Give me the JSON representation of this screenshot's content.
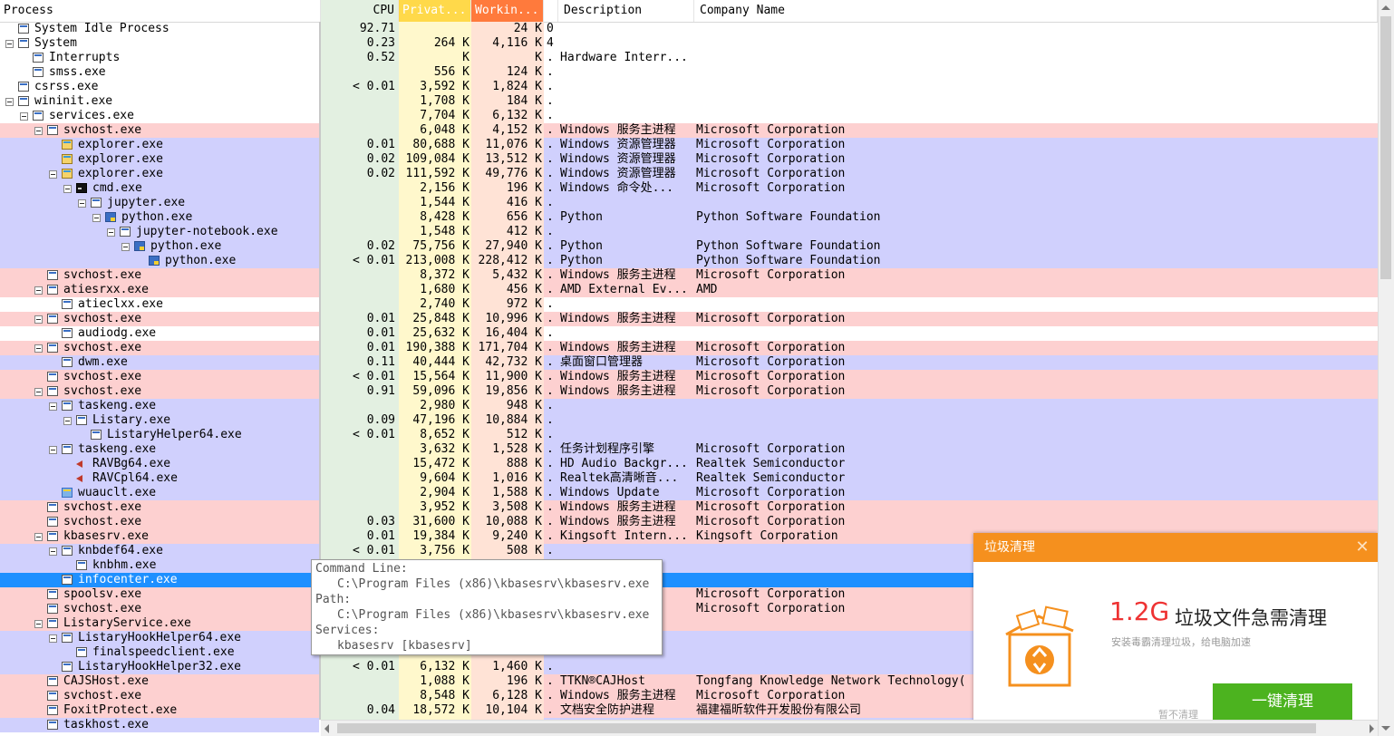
{
  "header": {
    "process": "Process",
    "cpu": "CPU",
    "private": "Privat...",
    "working": "Workin...",
    "description": "Description",
    "company": "Company Name"
  },
  "colors": {
    "service": "#fdd0d0",
    "own_process": "#d0d0fd",
    "selected": "#1e90ff",
    "cpu_column": "#e3f0e1",
    "private_column": "#fff8cc",
    "working_column": "#ffe3d6"
  },
  "processes": [
    {
      "name": "System Idle Process",
      "level": 0,
      "icon": "process-icon",
      "color": "none",
      "cpu": "92.71",
      "private": "",
      "working": "24 K",
      "dot": "0",
      "description": "",
      "company": ""
    },
    {
      "name": "System",
      "level": 0,
      "expand": true,
      "icon": "process-icon",
      "color": "none",
      "cpu": "0.23",
      "private": "264 K",
      "working": "4,116 K",
      "dot": "4",
      "description": "",
      "company": ""
    },
    {
      "name": "Interrupts",
      "level": 1,
      "icon": "process-icon",
      "color": "none",
      "cpu": "0.52",
      "private": "K",
      "working": "K",
      "dot": ".",
      "description": "Hardware Interr...",
      "company": ""
    },
    {
      "name": "smss.exe",
      "level": 1,
      "icon": "process-icon",
      "color": "none",
      "cpu": "",
      "private": "556 K",
      "working": "124 K",
      "dot": ".",
      "description": "",
      "company": ""
    },
    {
      "name": "csrss.exe",
      "level": 0,
      "icon": "process-icon",
      "color": "none",
      "cpu": "< 0.01",
      "private": "3,592 K",
      "working": "1,824 K",
      "dot": ".",
      "description": "",
      "company": ""
    },
    {
      "name": "wininit.exe",
      "level": 0,
      "expand": true,
      "icon": "process-icon",
      "color": "none",
      "cpu": "",
      "private": "1,708 K",
      "working": "184 K",
      "dot": ".",
      "description": "",
      "company": ""
    },
    {
      "name": "services.exe",
      "level": 1,
      "expand": true,
      "icon": "process-icon",
      "color": "none",
      "cpu": "",
      "private": "7,704 K",
      "working": "6,132 K",
      "dot": ".",
      "description": "",
      "company": ""
    },
    {
      "name": "svchost.exe",
      "level": 2,
      "expand": true,
      "icon": "process-icon",
      "color": "pink",
      "cpu": "",
      "private": "6,048 K",
      "working": "4,152 K",
      "dot": ".",
      "description": "Windows 服务主进程",
      "company": "Microsoft Corporation"
    },
    {
      "name": "explorer.exe",
      "level": 3,
      "icon": "explorer-icon",
      "color": "blue",
      "cpu": "0.01",
      "private": "80,688 K",
      "working": "11,076 K",
      "dot": ".",
      "description": "Windows 资源管理器",
      "company": "Microsoft Corporation"
    },
    {
      "name": "explorer.exe",
      "level": 3,
      "icon": "explorer-icon",
      "color": "blue",
      "cpu": "0.02",
      "private": "109,084 K",
      "working": "13,512 K",
      "dot": ".",
      "description": "Windows 资源管理器",
      "company": "Microsoft Corporation"
    },
    {
      "name": "explorer.exe",
      "level": 3,
      "expand": true,
      "icon": "explorer-icon",
      "color": "blue",
      "cpu": "0.02",
      "private": "111,592 K",
      "working": "49,776 K",
      "dot": ".",
      "description": "Windows 资源管理器",
      "company": "Microsoft Corporation"
    },
    {
      "name": "cmd.exe",
      "level": 4,
      "expand": true,
      "icon": "cmd-icon",
      "color": "blue",
      "cpu": "",
      "private": "2,156 K",
      "working": "196 K",
      "dot": ".",
      "description": "Windows 命令处...",
      "company": "Microsoft Corporation"
    },
    {
      "name": "jupyter.exe",
      "level": 5,
      "expand": true,
      "icon": "process-icon",
      "color": "blue",
      "cpu": "",
      "private": "1,544 K",
      "working": "416 K",
      "dot": ".",
      "description": "",
      "company": ""
    },
    {
      "name": "python.exe",
      "level": 6,
      "expand": true,
      "icon": "python-icon",
      "color": "blue",
      "cpu": "",
      "private": "8,428 K",
      "working": "656 K",
      "dot": ".",
      "description": "Python",
      "company": "Python Software Foundation"
    },
    {
      "name": "jupyter-notebook.exe",
      "level": 7,
      "expand": true,
      "icon": "process-icon",
      "color": "blue",
      "cpu": "",
      "private": "1,548 K",
      "working": "412 K",
      "dot": ".",
      "description": "",
      "company": ""
    },
    {
      "name": "python.exe",
      "level": 8,
      "expand": true,
      "icon": "python-icon",
      "color": "blue",
      "cpu": "0.02",
      "private": "75,756 K",
      "working": "27,940 K",
      "dot": ".",
      "description": "Python",
      "company": "Python Software Foundation"
    },
    {
      "name": "python.exe",
      "level": 9,
      "icon": "python-icon",
      "color": "blue",
      "cpu": "< 0.01",
      "private": "213,008 K",
      "working": "228,412 K",
      "dot": ".",
      "description": "Python",
      "company": "Python Software Foundation"
    },
    {
      "name": "svchost.exe",
      "level": 2,
      "icon": "process-icon",
      "color": "pink",
      "cpu": "",
      "private": "8,372 K",
      "working": "5,432 K",
      "dot": ".",
      "description": "Windows 服务主进程",
      "company": "Microsoft Corporation"
    },
    {
      "name": "atiesrxx.exe",
      "level": 2,
      "expand": true,
      "icon": "process-icon",
      "color": "pink",
      "cpu": "",
      "private": "1,680 K",
      "working": "456 K",
      "dot": ".",
      "description": "AMD External Ev...",
      "company": "AMD"
    },
    {
      "name": "atieclxx.exe",
      "level": 3,
      "icon": "process-icon",
      "color": "none",
      "cpu": "",
      "private": "2,740 K",
      "working": "972 K",
      "dot": ".",
      "description": "",
      "company": ""
    },
    {
      "name": "svchost.exe",
      "level": 2,
      "expand": true,
      "icon": "process-icon",
      "color": "pink",
      "cpu": "0.01",
      "private": "25,848 K",
      "working": "10,996 K",
      "dot": ".",
      "description": "Windows 服务主进程",
      "company": "Microsoft Corporation"
    },
    {
      "name": "audiodg.exe",
      "level": 3,
      "icon": "process-icon",
      "color": "none",
      "cpu": "0.01",
      "private": "25,632 K",
      "working": "16,404 K",
      "dot": ".",
      "description": "",
      "company": ""
    },
    {
      "name": "svchost.exe",
      "level": 2,
      "expand": true,
      "icon": "process-icon",
      "color": "pink",
      "cpu": "0.01",
      "private": "190,388 K",
      "working": "171,704 K",
      "dot": ".",
      "description": "Windows 服务主进程",
      "company": "Microsoft Corporation"
    },
    {
      "name": "dwm.exe",
      "level": 3,
      "icon": "process-icon",
      "color": "blue",
      "cpu": "0.11",
      "private": "40,444 K",
      "working": "42,732 K",
      "dot": ".",
      "description": "桌面窗口管理器",
      "company": "Microsoft Corporation"
    },
    {
      "name": "svchost.exe",
      "level": 2,
      "icon": "process-icon",
      "color": "pink",
      "cpu": "< 0.01",
      "private": "15,564 K",
      "working": "11,900 K",
      "dot": ".",
      "description": "Windows 服务主进程",
      "company": "Microsoft Corporation"
    },
    {
      "name": "svchost.exe",
      "level": 2,
      "expand": true,
      "icon": "process-icon",
      "color": "pink",
      "cpu": "0.91",
      "private": "59,096 K",
      "working": "19,856 K",
      "dot": ".",
      "description": "Windows 服务主进程",
      "company": "Microsoft Corporation"
    },
    {
      "name": "taskeng.exe",
      "level": 3,
      "expand": true,
      "icon": "process-icon",
      "color": "blue",
      "cpu": "",
      "private": "2,980 K",
      "working": "948 K",
      "dot": ".",
      "description": "",
      "company": ""
    },
    {
      "name": "Listary.exe",
      "level": 4,
      "expand": true,
      "icon": "process-icon",
      "color": "blue",
      "cpu": "0.09",
      "private": "47,196 K",
      "working": "10,884 K",
      "dot": ".",
      "description": "",
      "company": ""
    },
    {
      "name": "ListaryHelper64.exe",
      "level": 5,
      "icon": "process-icon",
      "color": "blue",
      "cpu": "< 0.01",
      "private": "8,652 K",
      "working": "512 K",
      "dot": ".",
      "description": "",
      "company": ""
    },
    {
      "name": "taskeng.exe",
      "level": 3,
      "expand": true,
      "icon": "process-icon",
      "color": "blue",
      "cpu": "",
      "private": "3,632 K",
      "working": "1,528 K",
      "dot": ".",
      "description": "任务计划程序引擎",
      "company": "Microsoft Corporation"
    },
    {
      "name": "RAVBg64.exe",
      "level": 4,
      "icon": "speaker-icon",
      "color": "blue",
      "cpu": "",
      "private": "15,472 K",
      "working": "888 K",
      "dot": ".",
      "description": "HD Audio Backgr...",
      "company": "Realtek Semiconductor"
    },
    {
      "name": "RAVCpl64.exe",
      "level": 4,
      "icon": "speaker-icon",
      "color": "blue",
      "cpu": "",
      "private": "9,604 K",
      "working": "1,016 K",
      "dot": ".",
      "description": "Realtek高清晰音...",
      "company": "Realtek Semiconductor"
    },
    {
      "name": "wuauclt.exe",
      "level": 3,
      "icon": "update-icon",
      "color": "blue",
      "cpu": "",
      "private": "2,904 K",
      "working": "1,588 K",
      "dot": ".",
      "description": "Windows Update",
      "company": "Microsoft Corporation"
    },
    {
      "name": "svchost.exe",
      "level": 2,
      "icon": "process-icon",
      "color": "pink",
      "cpu": "",
      "private": "3,952 K",
      "working": "3,508 K",
      "dot": ".",
      "description": "Windows 服务主进程",
      "company": "Microsoft Corporation"
    },
    {
      "name": "svchost.exe",
      "level": 2,
      "icon": "process-icon",
      "color": "pink",
      "cpu": "0.03",
      "private": "31,600 K",
      "working": "10,088 K",
      "dot": ".",
      "description": "Windows 服务主进程",
      "company": "Microsoft Corporation"
    },
    {
      "name": "kbasesrv.exe",
      "level": 2,
      "expand": true,
      "icon": "process-icon",
      "color": "pink",
      "cpu": "0.01",
      "private": "19,384 K",
      "working": "9,240 K",
      "dot": ".",
      "description": "Kingsoft Intern...",
      "company": "Kingsoft Corporation"
    },
    {
      "name": "knbdef64.exe",
      "level": 3,
      "expand": true,
      "icon": "process-icon",
      "color": "blue",
      "cpu": "< 0.01",
      "private": "3,756 K",
      "working": "508 K",
      "dot": ".",
      "description": "",
      "company": ""
    },
    {
      "name": "knbhm.exe",
      "level": 4,
      "icon": "process-icon",
      "color": "blue",
      "cpu": "",
      "private": "",
      "working": "",
      "dot": "",
      "description": "",
      "company": ""
    },
    {
      "name": "infocenter.exe",
      "level": 3,
      "icon": "process-icon",
      "color": "sel",
      "cpu": "",
      "private": "",
      "working": "",
      "dot": "",
      "description": "",
      "company": ""
    },
    {
      "name": "spoolsv.exe",
      "level": 2,
      "icon": "process-icon",
      "color": "pink",
      "cpu": "",
      "private": "",
      "working": "",
      "dot": "",
      "description": "...",
      "company": "Microsoft Corporation"
    },
    {
      "name": "svchost.exe",
      "level": 2,
      "icon": "process-icon",
      "color": "pink",
      "cpu": "",
      "private": "",
      "working": "",
      "dot": "",
      "description": "进程",
      "company": "Microsoft Corporation"
    },
    {
      "name": "ListaryService.exe",
      "level": 2,
      "expand": true,
      "icon": "process-icon",
      "color": "pink",
      "cpu": "",
      "private": "",
      "working": "",
      "dot": "",
      "description": "",
      "company": ""
    },
    {
      "name": "ListaryHookHelper64.exe",
      "level": 3,
      "expand": true,
      "icon": "process-icon",
      "color": "blue",
      "cpu": "",
      "private": "",
      "working": "",
      "dot": "",
      "description": "",
      "company": ""
    },
    {
      "name": "finalspeedclient.exe",
      "level": 4,
      "icon": "process-icon",
      "color": "blue",
      "cpu": "",
      "private": "",
      "working": "",
      "dot": "",
      "description": "",
      "company": ""
    },
    {
      "name": "ListaryHookHelper32.exe",
      "level": 3,
      "icon": "process-icon",
      "color": "blue",
      "cpu": "< 0.01",
      "private": "6,132 K",
      "working": "1,460 K",
      "dot": ".",
      "description": "",
      "company": ""
    },
    {
      "name": "CAJSHost.exe",
      "level": 2,
      "icon": "process-icon",
      "color": "pink",
      "cpu": "",
      "private": "1,088 K",
      "working": "196 K",
      "dot": ".",
      "description": "TTKN®CAJHost",
      "company": "Tongfang Knowledge Network Technology("
    },
    {
      "name": "svchost.exe",
      "level": 2,
      "icon": "process-icon",
      "color": "pink",
      "cpu": "",
      "private": "8,548 K",
      "working": "6,128 K",
      "dot": ".",
      "description": "Windows 服务主进程",
      "company": "Microsoft Corporation"
    },
    {
      "name": "FoxitProtect.exe",
      "level": 2,
      "icon": "process-icon",
      "color": "pink",
      "cpu": "0.04",
      "private": "18,572 K",
      "working": "10,104 K",
      "dot": ".",
      "description": "文档安全防护进程",
      "company": "福建福昕软件开发股份有限公司"
    },
    {
      "name": "taskhost.exe",
      "level": 2,
      "icon": "process-icon",
      "color": "blue",
      "cpu": "",
      "private": "",
      "working": "",
      "dot": "",
      "description": "",
      "company": ""
    }
  ],
  "tooltip": {
    "cmd_label": "Command Line:",
    "cmd_value": "C:\\Program Files (x86)\\kbasesrv\\kbasesrv.exe",
    "path_label": "Path:",
    "path_value": "C:\\Program Files (x86)\\kbasesrv\\kbasesrv.exe",
    "services_label": "Services:",
    "services_value": "kbasesrv [kbasesrv]"
  },
  "popup": {
    "title": "垃圾清理",
    "close": "✕",
    "size": "1.2G",
    "headline": "垃圾文件急需清理",
    "subtitle": "安装毒霸清理垃圾，给电脑加速",
    "skip": "暂不清理",
    "button": "一键清理",
    "accent": "#f5901e",
    "button_color": "#4cb31f"
  }
}
